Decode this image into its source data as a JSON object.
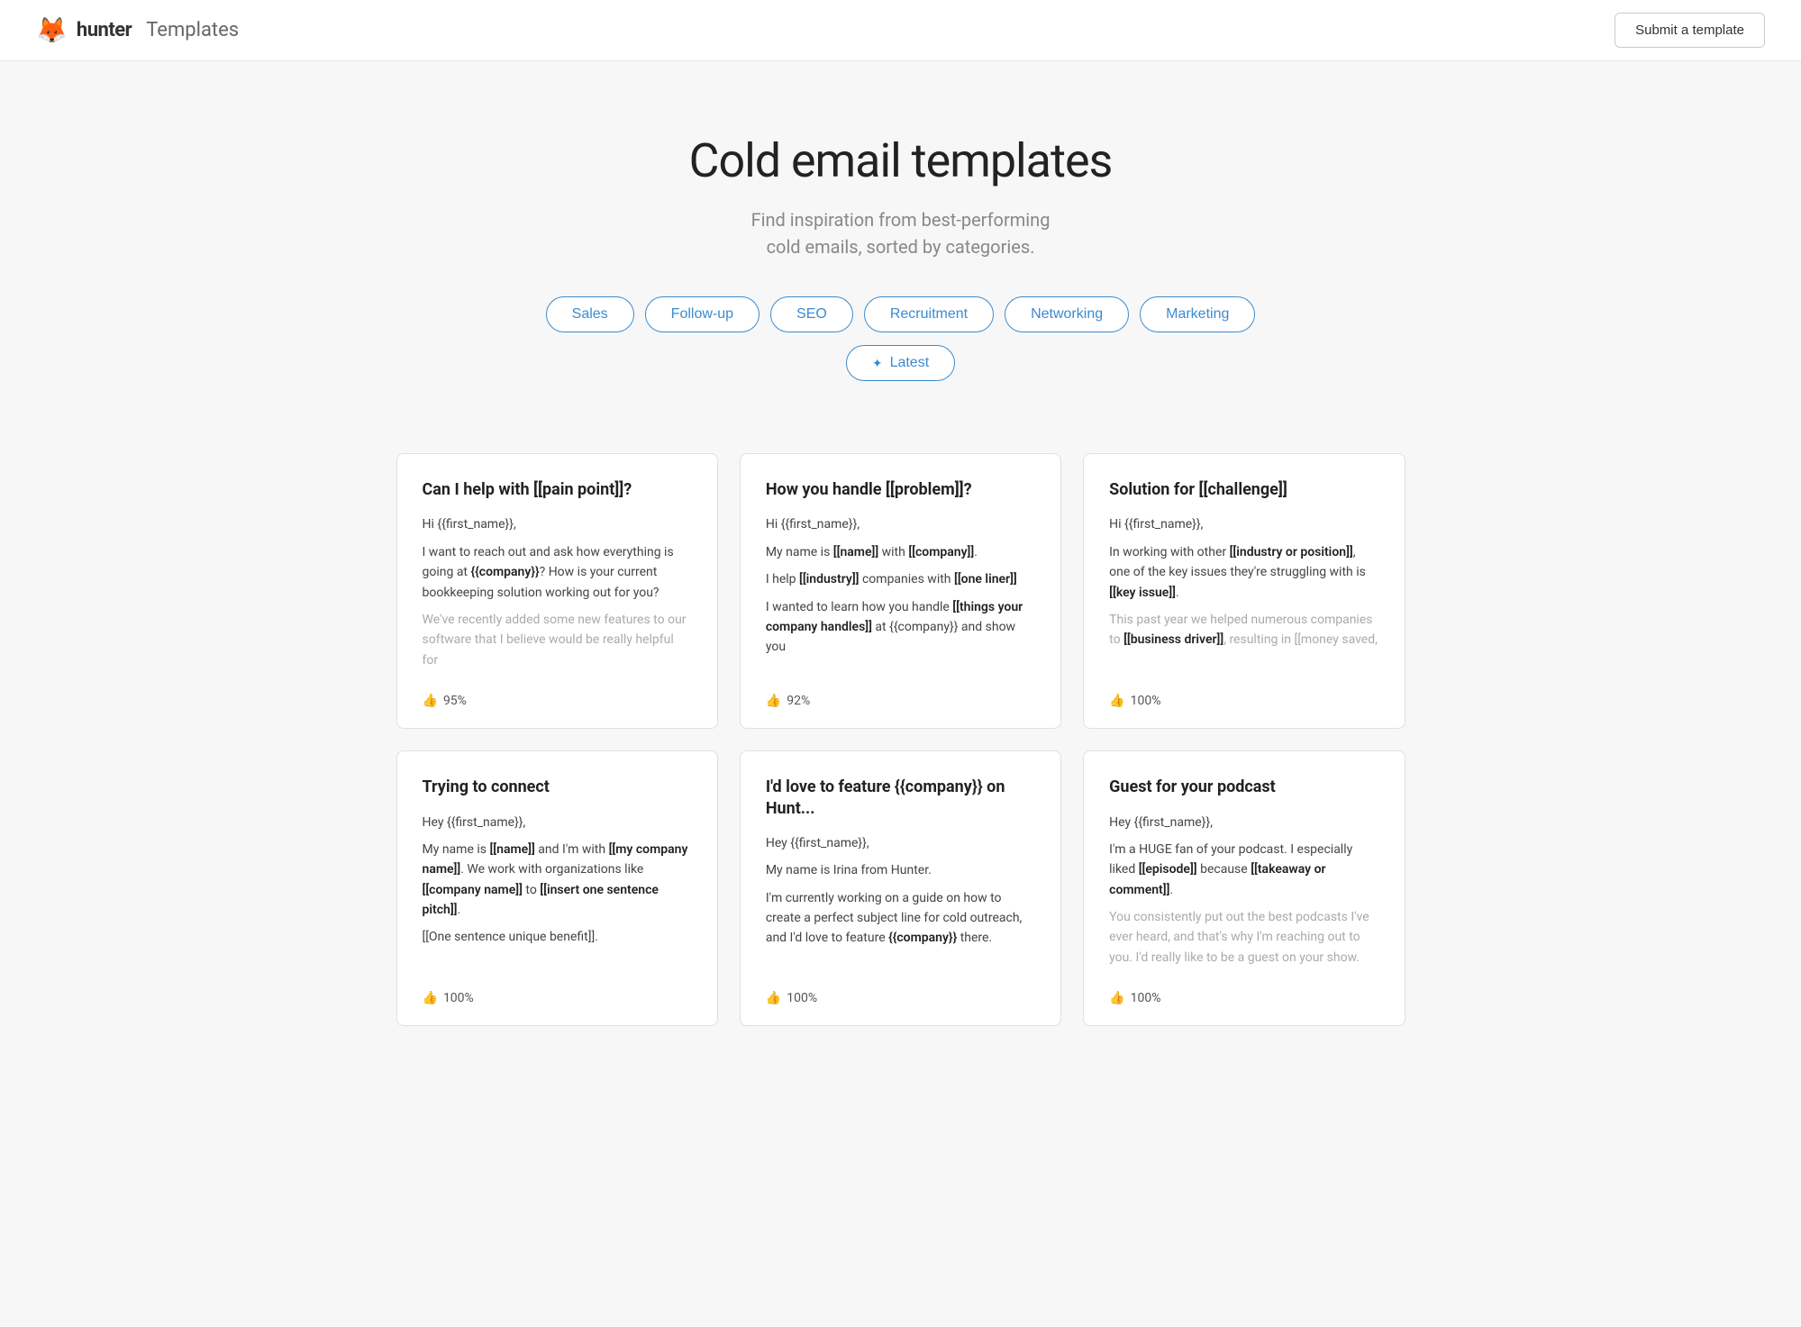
{
  "header": {
    "logo_icon": "🦊",
    "logo_text": "hunter",
    "logo_sub": "Templates",
    "submit_label": "Submit a template"
  },
  "hero": {
    "title": "Cold email templates",
    "subtitle_line1": "Find inspiration from best-performing",
    "subtitle_line2": "cold emails, sorted by categories."
  },
  "categories": [
    {
      "label": "Sales",
      "id": "sales"
    },
    {
      "label": "Follow-up",
      "id": "follow-up"
    },
    {
      "label": "SEO",
      "id": "seo"
    },
    {
      "label": "Recruitment",
      "id": "recruitment"
    },
    {
      "label": "Networking",
      "id": "networking"
    },
    {
      "label": "Marketing",
      "id": "marketing"
    }
  ],
  "latest_label": "Latest",
  "cards": [
    {
      "id": "card-1",
      "title": "Can I help with [[pain point]]?",
      "lines": [
        {
          "text": "Hi {{first_name}},",
          "faded": false
        },
        {
          "text": "I want to reach out and ask how everything is going at {{company}}? How is your current bookkeeping solution working out for you?",
          "faded": false
        },
        {
          "text": "We've recently added some new features to our software that I believe would be really helpful for",
          "faded": true
        }
      ],
      "rating": "95%"
    },
    {
      "id": "card-2",
      "title": "How you handle [[problem]]?",
      "lines": [
        {
          "text": "Hi {{first_name}},",
          "faded": false
        },
        {
          "text": "My name is [[name]] with [[company]].",
          "faded": false
        },
        {
          "text": "I help [[industry]] companies with [[one liner]]",
          "faded": false
        },
        {
          "text": "I wanted to learn how you handle [[things your company handles]] at {{company}} and show you",
          "faded": false
        }
      ],
      "rating": "92%"
    },
    {
      "id": "card-3",
      "title": "Solution for [[challenge]]",
      "lines": [
        {
          "text": "Hi {{first_name}},",
          "faded": false
        },
        {
          "text": "In working with other [[industry or position]], one of the key issues they're struggling with is [[key issue]].",
          "faded": false
        },
        {
          "text": "This past year we helped numerous companies to [[business driver]], resulting in [[money saved,",
          "faded": true
        }
      ],
      "rating": "100%"
    },
    {
      "id": "card-4",
      "title": "Trying to connect",
      "lines": [
        {
          "text": "Hey {{first_name}},",
          "faded": false
        },
        {
          "text": "My name is [[name]] and I'm with [[my company name]]. We work with organizations like [[company name]] to [[insert one sentence pitch]].",
          "faded": false
        },
        {
          "text": "[[One sentence unique benefit]].",
          "faded": false
        }
      ],
      "rating": "100%"
    },
    {
      "id": "card-5",
      "title": "I'd love to feature {{company}} on Hunt...",
      "lines": [
        {
          "text": "Hey {{first_name}},",
          "faded": false
        },
        {
          "text": "My name is Irina from Hunter.",
          "faded": false
        },
        {
          "text": "I'm currently working on a guide on how to create a perfect subject line for cold outreach, and I'd love to feature {{company}} there.",
          "faded": false
        }
      ],
      "rating": "100%"
    },
    {
      "id": "card-6",
      "title": "Guest for your podcast",
      "lines": [
        {
          "text": "Hey {{first_name}},",
          "faded": false
        },
        {
          "text": "I'm a HUGE fan of your podcast. I especially liked [[episode]] because [[takeaway or comment]].",
          "faded": false
        },
        {
          "text": "You consistently put out the best podcasts I've ever heard, and that's why I'm reaching out to you. I'd really like to be a guest on your show.",
          "faded": true
        }
      ],
      "rating": "100%"
    }
  ]
}
